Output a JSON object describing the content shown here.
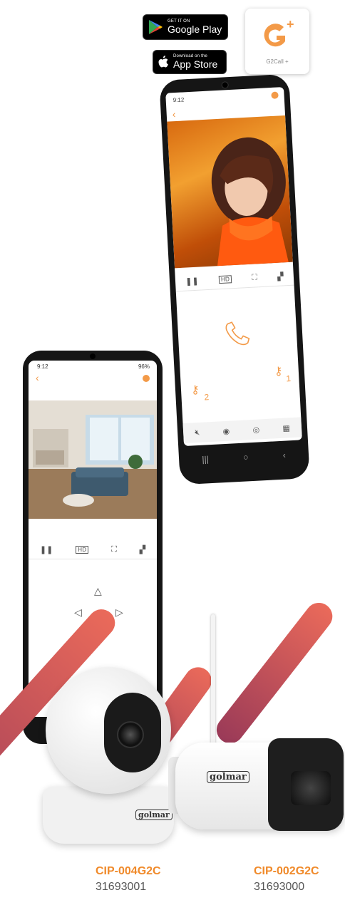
{
  "badges": {
    "google_play": {
      "small": "GET IT ON",
      "big": "Google Play"
    },
    "app_store": {
      "small": "Download on the",
      "big": "App Store"
    }
  },
  "app_tile": {
    "logo": "G",
    "plus": "+",
    "label": "G2Call +"
  },
  "phone_right": {
    "status_time": "9:12",
    "keys": [
      {
        "label": "2"
      },
      {
        "label": "1"
      }
    ],
    "controls": [
      "pause-icon",
      "hd-icon",
      "fullscreen-icon",
      "grid-icon"
    ],
    "bottom": [
      "mute-icon",
      "record-icon",
      "camera-icon",
      "qr-icon"
    ]
  },
  "phone_left": {
    "status_time": "9:12",
    "status_right": "96%",
    "controls": [
      "pause-icon",
      "hd-icon",
      "fullscreen-icon",
      "grid-icon"
    ]
  },
  "products": [
    {
      "code": "CIP-004G2C",
      "number": "31693001",
      "brand": "golmar"
    },
    {
      "code": "CIP-002G2C",
      "number": "31693000",
      "brand": "golmar"
    }
  ],
  "colors": {
    "accent": "#f39a48",
    "stripe_top": "#ea6a5a",
    "stripe_bottom": "#9a3a58"
  }
}
